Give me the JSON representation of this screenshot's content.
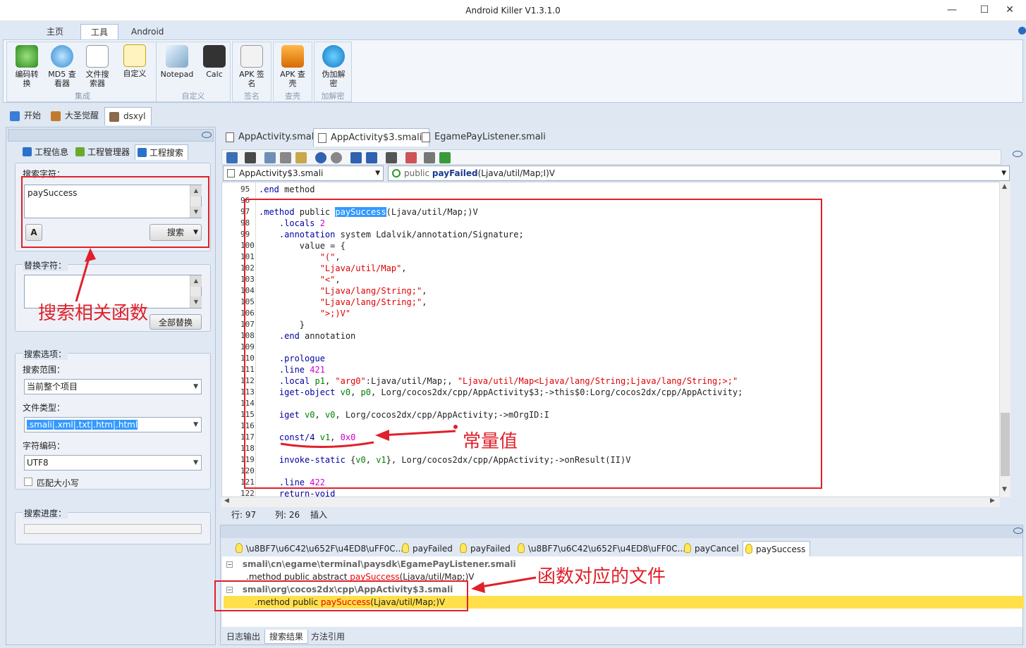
{
  "window": {
    "title": "Android Killer V1.3.1.0",
    "min": "—",
    "max": "☐",
    "close": "✕"
  },
  "ribbon": {
    "tabs": [
      "主页",
      "工具",
      "Android"
    ],
    "active_tab": 1,
    "groups": [
      {
        "label": "集成",
        "buttons": [
          "编码转换",
          "MD5 查看器",
          "文件搜索器"
        ]
      },
      {
        "label": "",
        "buttons": [
          "自定义"
        ]
      },
      {
        "label": "自定义",
        "buttons": [
          "Notepad",
          "Calc"
        ]
      },
      {
        "label": "签名",
        "buttons": [
          "APK 签名"
        ]
      },
      {
        "label": "查壳",
        "buttons": [
          "APK 查壳"
        ]
      },
      {
        "label": "加解密",
        "buttons": [
          "伪加解密"
        ]
      }
    ]
  },
  "doctabs": [
    "开始",
    "大圣觉醒",
    "dsxyl"
  ],
  "left": {
    "tabs": [
      "工程信息",
      "工程管理器",
      "工程搜索"
    ],
    "search_label": "搜索字符：",
    "search_value": "paySuccess",
    "search_button": "搜索",
    "replace_label": "替换字符：",
    "replace_all": "全部替换",
    "options_label": "搜索选项：",
    "scope_label": "搜索范围：",
    "scope_value": "当前整个项目",
    "filetype_label": "文件类型：",
    "filetype_value": ".smali|.xml|.txt|.htm|.html",
    "encoding_label": "字符编码：",
    "encoding_value": "UTF8",
    "match_case": "匹配大小写",
    "progress_label": "搜索进度："
  },
  "editor": {
    "file_tabs": [
      "AppActivity.smali",
      "AppActivity$3.smali",
      "EgamePayListener.smali"
    ],
    "active_file": 1,
    "class_combo": "AppActivity$3.smali",
    "method_combo_prefix": "public ",
    "method_combo_name": "payFailed",
    "method_combo_sig": "(Ljava/util/Map;I)V",
    "lines": [
      {
        "n": "95",
        "t": ".end method"
      },
      {
        "n": "96",
        "t": ""
      },
      {
        "n": "97",
        "t": ".method public paySuccess(Ljava/util/Map;)V"
      },
      {
        "n": "98",
        "t": "    .locals 2"
      },
      {
        "n": "99",
        "t": "    .annotation system Ldalvik/annotation/Signature;"
      },
      {
        "n": "100",
        "t": "        value = {"
      },
      {
        "n": "101",
        "t": "            \"(\","
      },
      {
        "n": "102",
        "t": "            \"Ljava/util/Map\","
      },
      {
        "n": "103",
        "t": "            \"<\","
      },
      {
        "n": "104",
        "t": "            \"Ljava/lang/String;\","
      },
      {
        "n": "105",
        "t": "            \"Ljava/lang/String;\","
      },
      {
        "n": "106",
        "t": "            \">;)V\""
      },
      {
        "n": "107",
        "t": "        }"
      },
      {
        "n": "108",
        "t": "    .end annotation"
      },
      {
        "n": "109",
        "t": ""
      },
      {
        "n": "110",
        "t": "    .prologue"
      },
      {
        "n": "111",
        "t": "    .line 421"
      },
      {
        "n": "112",
        "t": "    .local p1, \"arg0\":Ljava/util/Map;, \"Ljava/util/Map<Ljava/lang/String;Ljava/lang/String;>;\""
      },
      {
        "n": "113",
        "t": "    iget-object v0, p0, Lorg/cocos2dx/cpp/AppActivity$3;->this$0:Lorg/cocos2dx/cpp/AppActivity;"
      },
      {
        "n": "114",
        "t": ""
      },
      {
        "n": "115",
        "t": "    iget v0, v0, Lorg/cocos2dx/cpp/AppActivity;->mOrgID:I"
      },
      {
        "n": "116",
        "t": ""
      },
      {
        "n": "117",
        "t": "    const/4 v1, 0x0"
      },
      {
        "n": "118",
        "t": ""
      },
      {
        "n": "119",
        "t": "    invoke-static {v0, v1}, Lorg/cocos2dx/cpp/AppActivity;->onResult(II)V"
      },
      {
        "n": "120",
        "t": ""
      },
      {
        "n": "121",
        "t": "    .line 422"
      },
      {
        "n": "122",
        "t": "    return-void"
      }
    ],
    "status_row": "行: 97",
    "status_col": "列: 26",
    "status_mode": "插入"
  },
  "bottom": {
    "tabs": [
      "\\u8BF7\\u6C42\\u652F\\u4ED8\\uFF0C...",
      "payFailed",
      "payFailed",
      "\\u8BF7\\u6C42\\u652F\\u4ED8\\uFF0C...",
      "payCancel",
      "paySuccess"
    ],
    "active_tab": 5,
    "results": [
      {
        "file": "smali\\cn\\egame\\terminal\\paysdk\\EgamePayListener.smali",
        "pre": ".method public abstract ",
        "hit": "paySuccess",
        "post": "(Ljava/util/Map;)V"
      },
      {
        "file": "smali\\org\\cocos2dx\\cpp\\AppActivity$3.smali",
        "pre": ".method public ",
        "hit": "paySuccess",
        "post": "(Ljava/util/Map;)V"
      }
    ],
    "footer_tabs": [
      "日志输出",
      "搜索结果",
      "方法引用"
    ],
    "active_footer": 1
  },
  "annotations": {
    "search": "搜索相关函数",
    "const": "常量值",
    "file": "函数对应的文件"
  }
}
